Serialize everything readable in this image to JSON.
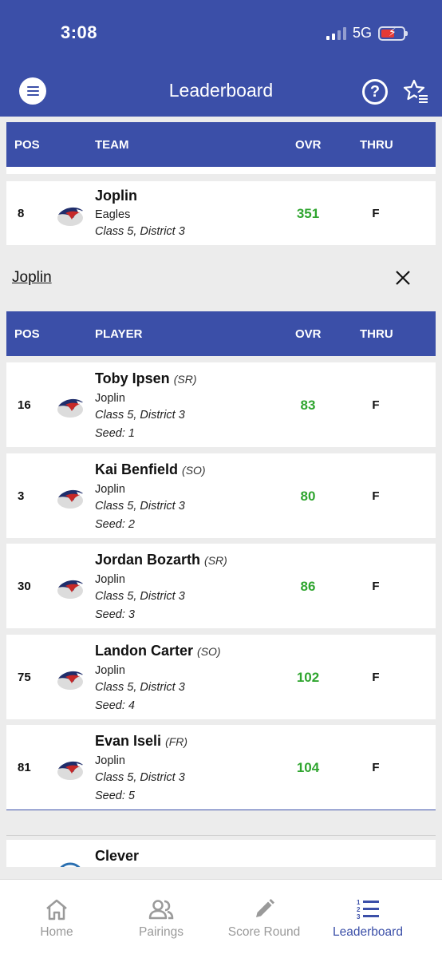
{
  "status": {
    "time": "3:08",
    "network": "5G"
  },
  "app": {
    "title": "Leaderboard"
  },
  "team_table": {
    "headers": {
      "pos": "POS",
      "team": "TEAM",
      "ovr": "OVR",
      "thru": "THRU"
    },
    "rows": [
      {
        "pos": "8",
        "name": "Joplin",
        "mascot": "Eagles",
        "class": "Class 5, District 3",
        "ovr": "351",
        "thru": "F"
      }
    ]
  },
  "expanded_team": {
    "name": "Joplin"
  },
  "player_table": {
    "headers": {
      "pos": "POS",
      "player": "PLAYER",
      "ovr": "OVR",
      "thru": "THRU"
    },
    "rows": [
      {
        "pos": "16",
        "name": "Toby Ipsen",
        "year": "(SR)",
        "school": "Joplin",
        "class": "Class 5, District 3",
        "seed": "Seed: 1",
        "ovr": "83",
        "thru": "F"
      },
      {
        "pos": "3",
        "name": "Kai Benfield",
        "year": "(SO)",
        "school": "Joplin",
        "class": "Class 5, District 3",
        "seed": "Seed: 2",
        "ovr": "80",
        "thru": "F"
      },
      {
        "pos": "30",
        "name": "Jordan Bozarth",
        "year": "(SR)",
        "school": "Joplin",
        "class": "Class 5, District 3",
        "seed": "Seed: 3",
        "ovr": "86",
        "thru": "F"
      },
      {
        "pos": "75",
        "name": "Landon Carter",
        "year": "(SO)",
        "school": "Joplin",
        "class": "Class 5, District 3",
        "seed": "Seed: 4",
        "ovr": "102",
        "thru": "F"
      },
      {
        "pos": "81",
        "name": "Evan Iseli",
        "year": "(FR)",
        "school": "Joplin",
        "class": "Class 5, District 3",
        "seed": "Seed: 5",
        "ovr": "104",
        "thru": "F"
      }
    ]
  },
  "next_team": {
    "name": "Clever"
  },
  "tabs": [
    {
      "label": "Home",
      "icon": "home-icon",
      "active": false
    },
    {
      "label": "Pairings",
      "icon": "people-icon",
      "active": false
    },
    {
      "label": "Score Round",
      "icon": "pencil-icon",
      "active": false
    },
    {
      "label": "Leaderboard",
      "icon": "ranked-list-icon",
      "active": true
    }
  ],
  "colors": {
    "brand": "#3b4fa8",
    "score": "#2fa52f",
    "inactive_tab": "#9a9a9a"
  }
}
